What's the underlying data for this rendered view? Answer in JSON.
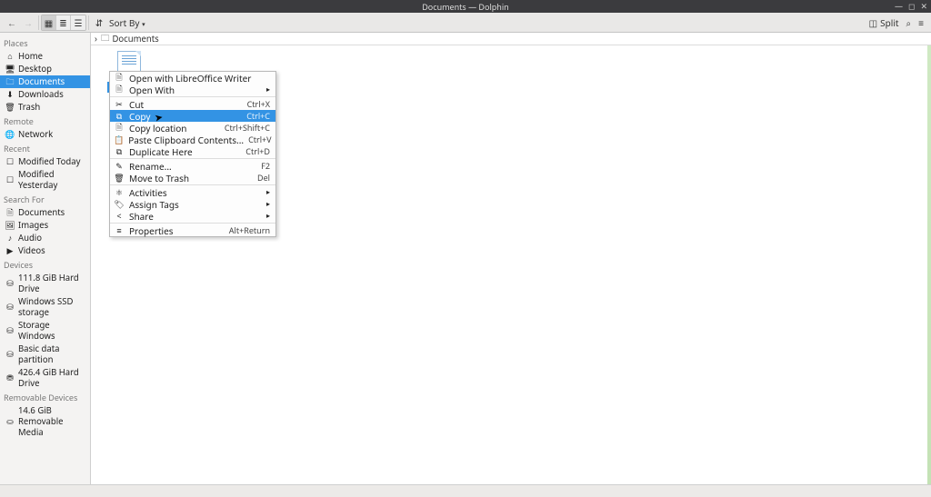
{
  "window": {
    "title": "Documents — Dolphin"
  },
  "toolbar": {
    "sort_label": "Sort By",
    "split_label": "Split"
  },
  "sidebar": {
    "places_header": "Places",
    "places": [
      {
        "icon": "⌂",
        "label": "Home"
      },
      {
        "icon": "🖥",
        "label": "Desktop"
      },
      {
        "icon": "🗀",
        "label": "Documents",
        "selected": true
      },
      {
        "icon": "⬇",
        "label": "Downloads"
      },
      {
        "icon": "🗑",
        "label": "Trash"
      }
    ],
    "remote_header": "Remote",
    "remote": [
      {
        "icon": "🌐",
        "label": "Network"
      }
    ],
    "recent_header": "Recent",
    "recent": [
      {
        "icon": "☐",
        "label": "Modified Today"
      },
      {
        "icon": "☐",
        "label": "Modified Yesterday"
      }
    ],
    "search_header": "Search For",
    "search": [
      {
        "icon": "🗎",
        "label": "Documents"
      },
      {
        "icon": "🖼",
        "label": "Images"
      },
      {
        "icon": "♪",
        "label": "Audio"
      },
      {
        "icon": "▶",
        "label": "Videos"
      }
    ],
    "devices_header": "Devices",
    "devices": [
      {
        "icon": "⛁",
        "label": "111.8 GiB Hard Drive"
      },
      {
        "icon": "⛁",
        "label": "Windows SSD storage"
      },
      {
        "icon": "⛁",
        "label": "Storage Windows"
      },
      {
        "icon": "⛁",
        "label": "Basic data partition"
      },
      {
        "icon": "⛃",
        "label": "426.4 GiB Hard Drive"
      }
    ],
    "removable_header": "Removable Devices",
    "removable": [
      {
        "icon": "⛀",
        "label": "14.6 GiB Removable Media"
      }
    ]
  },
  "breadcrumb": {
    "current": "Documents"
  },
  "context_menu": {
    "items": [
      {
        "icon": "🗎",
        "label": "Open with LibreOffice Writer",
        "shortcut": ""
      },
      {
        "icon": "🗎",
        "label": "Open With",
        "shortcut": "",
        "submenu": true
      },
      "---",
      {
        "icon": "✂",
        "label": "Cut",
        "shortcut": "Ctrl+X"
      },
      {
        "icon": "⧉",
        "label": "Copy",
        "shortcut": "Ctrl+C",
        "highlight": true
      },
      {
        "icon": "🗎",
        "label": "Copy location",
        "shortcut": "Ctrl+Shift+C"
      },
      {
        "icon": "📋",
        "label": "Paste Clipboard Contents...",
        "shortcut": "Ctrl+V"
      },
      {
        "icon": "⧉",
        "label": "Duplicate Here",
        "shortcut": "Ctrl+D"
      },
      "---",
      {
        "icon": "✎",
        "label": "Rename...",
        "shortcut": "F2"
      },
      {
        "icon": "🗑",
        "label": "Move to Trash",
        "shortcut": "Del"
      },
      "---",
      {
        "icon": "⚛",
        "label": "Activities",
        "shortcut": "",
        "submenu": true
      },
      {
        "icon": "🏷",
        "label": "Assign Tags",
        "shortcut": "",
        "submenu": true
      },
      {
        "icon": "<",
        "label": "Share",
        "shortcut": "",
        "submenu": true
      },
      "---",
      {
        "icon": "≡",
        "label": "Properties",
        "shortcut": "Alt+Return"
      }
    ]
  },
  "statusbar": {
    "text": ""
  }
}
